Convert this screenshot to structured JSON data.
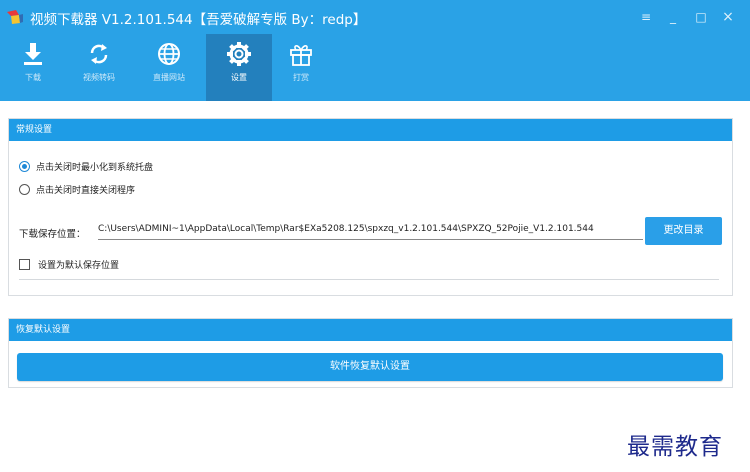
{
  "window": {
    "title": "视频下载器 V1.2.101.544【吾爱破解专版 By：redp】",
    "controls": {
      "menu": "≡",
      "minimize": "_",
      "maximize": "□",
      "close": "×"
    }
  },
  "nav": {
    "items": [
      {
        "label": "下载",
        "icon": "download-icon"
      },
      {
        "label": "视频转码",
        "icon": "convert-icon"
      },
      {
        "label": "直播网站",
        "icon": "globe-icon"
      },
      {
        "label": "设置",
        "icon": "gear-icon",
        "active": true
      },
      {
        "label": "打赏",
        "icon": "gift-icon"
      }
    ]
  },
  "general": {
    "header": "常规设置",
    "option_minimize": "点击关闭时最小化到系统托盘",
    "option_exit": "点击关闭时直接关闭程序",
    "selected": "option_minimize",
    "path_label": "下载保存位置：",
    "path_value": "C:\\Users\\ADMINI~1\\AppData\\Local\\Temp\\Rar$EXa5208.125\\spxzq_v1.2.101.544\\SPXZQ_52Pojie_V1.2.101.544",
    "change_dir_button": "更改目录",
    "default_path_label": "设置为默认保存位置",
    "default_path_checked": false
  },
  "restore": {
    "header": "恢复默认设置",
    "button": "软件恢复默认设置"
  },
  "watermark": "最需教育",
  "colors": {
    "title_bar": "#2aa2e6",
    "active_tab": "#2380bd",
    "panel_header": "#1e9ce6",
    "button": "#2a9fe8"
  }
}
